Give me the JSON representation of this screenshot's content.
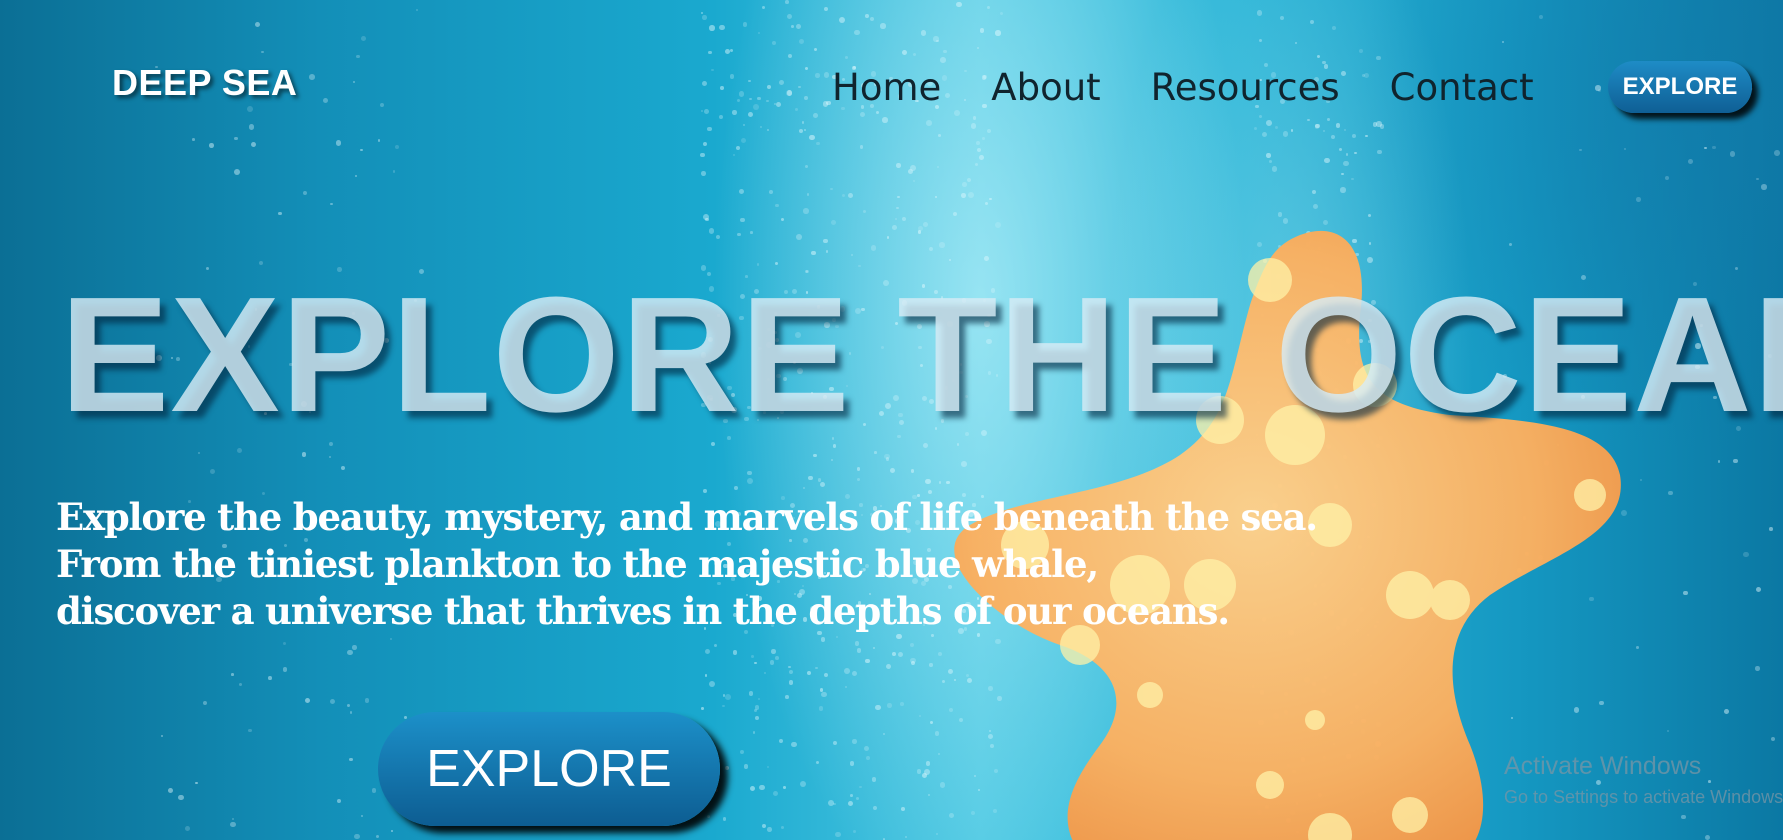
{
  "header": {
    "logo": "DEEP SEA",
    "nav": [
      "Home",
      "About",
      "Resources",
      "Contact"
    ],
    "button_label": "EXPLORE"
  },
  "hero": {
    "title": "EXPLORE THE OCEAN",
    "description_lines": [
      "Explore the beauty, mystery, and marvels of life beneath the sea.",
      "From the tiniest plankton to the majestic blue whale,",
      "discover a universe that thrives in the depths of our oceans."
    ],
    "cta_label": "EXPLORE"
  },
  "watermark": {
    "title": "Activate Windows",
    "subtitle": "Go to Settings to activate Windows."
  },
  "colors": {
    "ocean": "#1aa9cf",
    "button": "#0f5f95",
    "starfish": "#f7a24e"
  }
}
